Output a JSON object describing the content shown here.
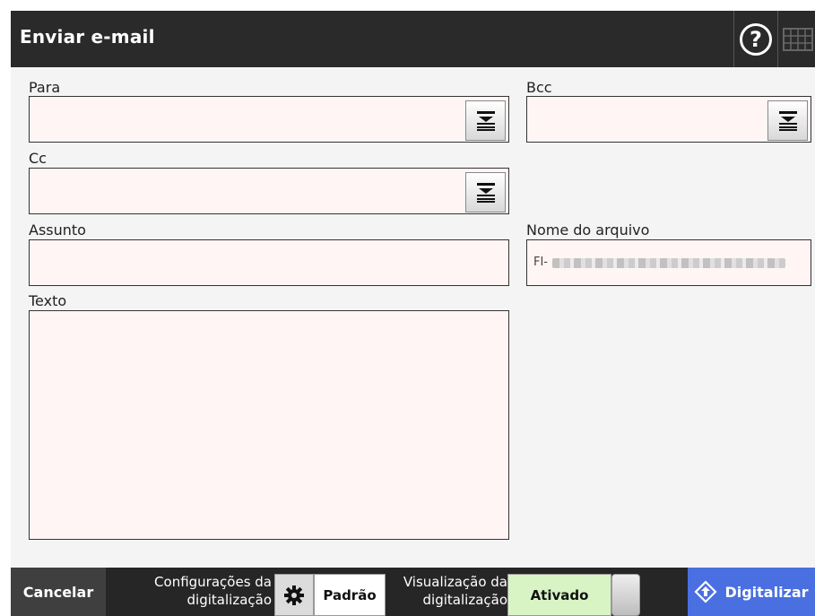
{
  "window": {
    "title": "Enviar e-mail"
  },
  "header": {
    "help_icon": "help-circle-icon",
    "help_glyph": "?",
    "keyboard_icon": "keyboard-icon"
  },
  "form": {
    "to": {
      "label": "Para",
      "value": ""
    },
    "bcc": {
      "label": "Bcc",
      "value": ""
    },
    "cc": {
      "label": "Cc",
      "value": ""
    },
    "subject": {
      "label": "Assunto",
      "value": ""
    },
    "filename": {
      "label": "Nome do arquivo",
      "value_prefix": "FI-"
    },
    "body": {
      "label": "Texto",
      "value": ""
    }
  },
  "footer": {
    "cancel_label": "Cancelar",
    "scan_settings_label_line1": "Configurações da",
    "scan_settings_label_line2": "digitalização",
    "scan_settings_value": "Padrão",
    "preview_label_line1": "Visualização da",
    "preview_label_line2": "digitalização",
    "preview_value": "Ativado",
    "scan_label": "Digitalizar"
  },
  "colors": {
    "titlebar": "#2a2a2a",
    "field_background": "#fff5f5",
    "preview_on": "#d8f4c4",
    "scan_button": "#4a6fe0"
  }
}
